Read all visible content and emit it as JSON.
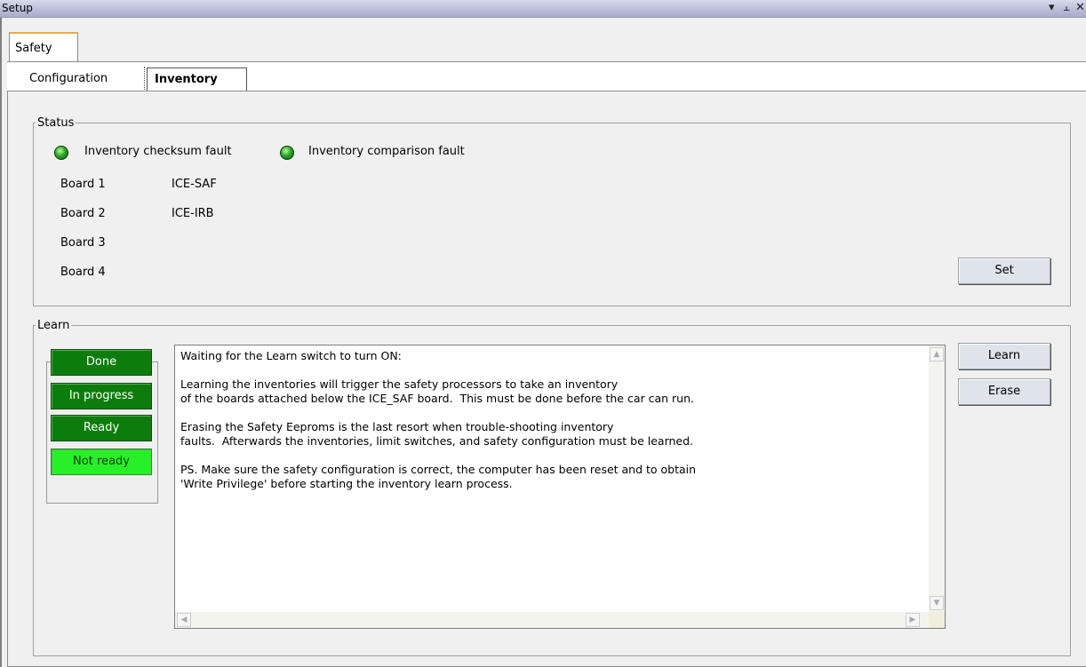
{
  "window": {
    "title": "Setup",
    "controls": [
      "▾",
      " \u0000",
      "×"
    ]
  },
  "tabs": {
    "primary": "Safety",
    "secondary": [
      "Configuration",
      "Inventory"
    ],
    "active_secondary": "Inventory"
  },
  "status": {
    "legend": "Status",
    "checksum_fault": "Inventory checksum fault",
    "comparison_fault": "Inventory comparison fault",
    "boards": [
      {
        "label": "Board 1",
        "value": "ICE-SAF"
      },
      {
        "label": "Board 2",
        "value": "ICE-IRB"
      },
      {
        "label": "Board 3",
        "value": ""
      },
      {
        "label": "Board 4",
        "value": ""
      }
    ],
    "set_button": "Set"
  },
  "learn": {
    "legend": "Learn",
    "indicators": [
      "Done",
      "In progress",
      "Ready",
      "Not ready"
    ],
    "learn_button": "Learn",
    "erase_button": "Erase",
    "message": "Waiting for the Learn switch to turn ON:\n\nLearning the inventories will trigger the safety processors to take an inventory\nof the boards attached below the ICE_SAF board.  This must be done before the car can run.\n\nErasing the Safety Eeproms is the last resort when trouble-shooting inventory\nfaults.  Afterwards the inventories, limit switches, and safety configuration must be learned.\n\nPS. Make sure the safety configuration is correct, the computer has been reset and to obtain\n'Write Privilege' before starting the inventory learn process."
  },
  "colors": {
    "indicator_active": "#0c7d0c",
    "indicator_highlight": "#28f028",
    "tab_accent": "#f2a93b"
  }
}
